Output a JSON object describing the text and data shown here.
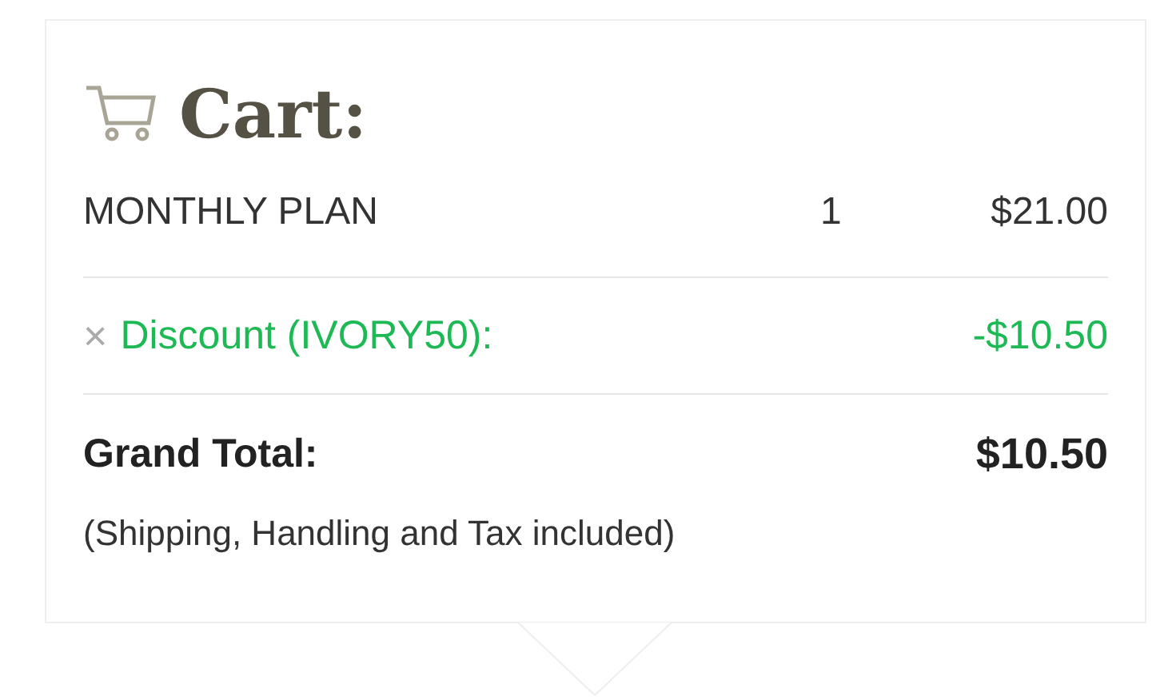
{
  "cart": {
    "title": "Cart:",
    "items": [
      {
        "name": "MONTHLY PLAN",
        "quantity": "1",
        "price": "$21.00"
      }
    ],
    "discount": {
      "remove": "×",
      "label": "Discount (IVORY50):",
      "amount": "-$10.50"
    },
    "total": {
      "label": "Grand Total:",
      "amount": "$10.50",
      "note": "(Shipping, Handling and Tax included)"
    }
  }
}
